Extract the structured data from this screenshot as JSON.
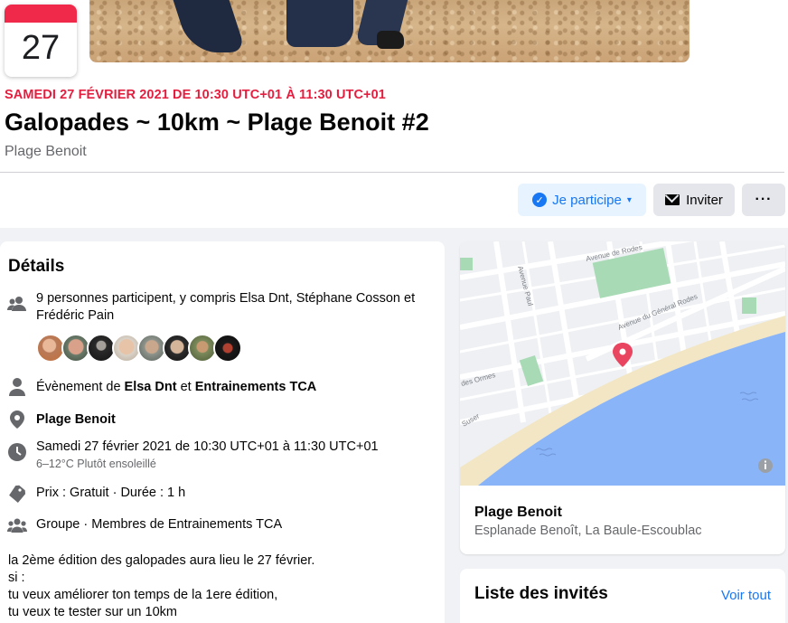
{
  "event": {
    "calendar_day": "27",
    "date_line": "SAMEDI 27 FÉVRIER 2021 DE 10:30 UTC+01 À 11:30 UTC+01",
    "title": "Galopades ~ 10km ~ Plage Benoit #2",
    "location": "Plage Benoit"
  },
  "actions": {
    "going_label": "Je participe",
    "invite_label": "Inviter",
    "more_label": "···"
  },
  "details": {
    "heading": "Détails",
    "attendance_line1": "9 personnes participent, y compris Elsa Dnt, Stéphane Cosson et",
    "attendance_line2": "Frédéric Pain",
    "organizer_prefix": "Évènement de",
    "organizer_1": "Elsa Dnt",
    "organizer_joiner": "et",
    "organizer_2": "Entrainements TCA",
    "place": "Plage Benoit",
    "datetime": "Samedi 27 février 2021 de 10:30 UTC+01 à 11:30 UTC+01",
    "weather": "6–12°C Plutôt ensoleillé",
    "price": "Prix : Gratuit · Durée : 1 h",
    "group": "Groupe · Membres de Entrainements TCA",
    "description": [
      "la 2ème édition des galopades aura lieu le 27 février.",
      "si :",
      "tu veux améliorer ton temps de la 1ere édition,",
      "tu veux te tester sur un 10km"
    ]
  },
  "map": {
    "street_labels": [
      "Avenue de Rodes",
      "Avenue Paul",
      "Avenue du Général Rodes",
      "des Ormes",
      "Suser"
    ],
    "place_name": "Plage Benoit",
    "address": "Esplanade Benoît, La Baule-Escoublac"
  },
  "guests": {
    "heading": "Liste des invités",
    "see_all": "Voir tout"
  },
  "colors": {
    "accent": "#1877f2",
    "date_red": "#e41e3f",
    "calendar_band": "#f02849",
    "sea": "#8ab4f8",
    "park": "#9fd5a0",
    "beach": "#f2e6c4"
  }
}
